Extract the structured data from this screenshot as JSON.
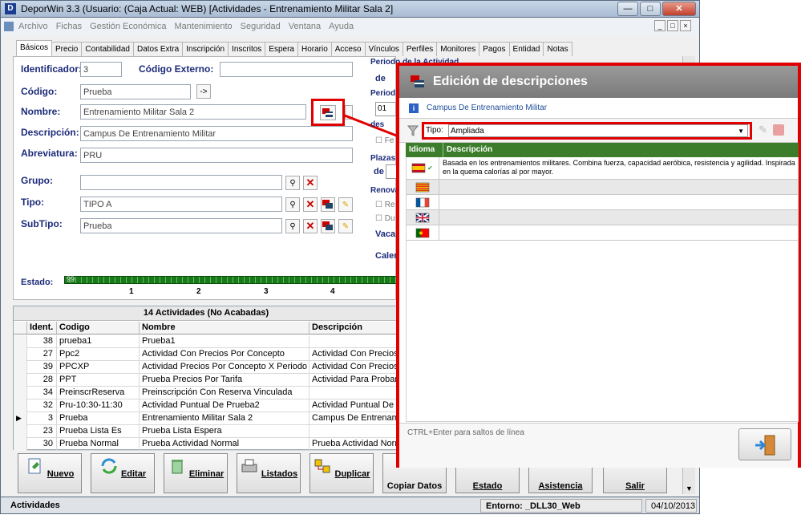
{
  "window": {
    "title": "DeporWin 3.3  (Usuario:              (Caja Actual: WEB)  [Actividades - Entrenamiento Militar Sala 2]",
    "app_icon": "D"
  },
  "menu": [
    "Archivo",
    "Fichas",
    "Gestión Económica",
    "Mantenimiento",
    "Seguridad",
    "Ventana",
    "Ayuda"
  ],
  "tabs": [
    "Básicos",
    "Precio",
    "Contabilidad",
    "Datos Extra",
    "Inscripción",
    "Inscritos",
    "Espera",
    "Horario",
    "Acceso",
    "Vínculos",
    "Perfiles",
    "Monitores",
    "Pagos",
    "Entidad",
    "Notas"
  ],
  "form": {
    "identificador_label": "Identificador:",
    "identificador": "3",
    "codigo_externo_label": "Código Externo:",
    "codigo_externo": "",
    "codigo_label": "Código:",
    "codigo": "Prueba",
    "codigo_btn": "->",
    "nombre_label": "Nombre:",
    "nombre": "Entrenamiento Militar Sala 2",
    "descripcion_label": "Descripción:",
    "descripcion": "Campus De Entrenamiento Militar",
    "abreviatura_label": "Abreviatura:",
    "abreviatura": "PRU",
    "grupo_label": "Grupo:",
    "grupo": "",
    "tipo_label": "Tipo:",
    "tipo": "TIPO A",
    "subtipo_label": "SubTipo:",
    "subtipo": "Prueba",
    "estado_label": "Estado:",
    "estado_value": "99",
    "estado_ticks": [
      "1",
      "2",
      "3",
      "4"
    ]
  },
  "right_panel": {
    "periodo_actividad": "Periodo de la Actividad",
    "de1": "de",
    "periodo2": "Period",
    "date_prefix": "01",
    "fe": "Fe",
    "desc_prefix": "des",
    "plazas": "Plazas",
    "de2": "de",
    "renova": "Renova",
    "re": "Re",
    "du": "Du",
    "vaca": "Vaca",
    "calen": "Calen"
  },
  "grid": {
    "header": "14 Actividades  (No Acabadas)",
    "columns": [
      "Ident.",
      "Codigo",
      "Nombre",
      "Descripción"
    ],
    "current_marker": "▶",
    "rows": [
      {
        "id": "38",
        "codigo": "prueba1",
        "nombre": "Prueba1",
        "descripcion": ""
      },
      {
        "id": "27",
        "codigo": "Ppc2",
        "nombre": "Actividad Con Precios Por Concepto",
        "descripcion": "Actividad Con Precios P"
      },
      {
        "id": "39",
        "codigo": "PPCXP",
        "nombre": "Actividad Precios Por Concepto X Periodo",
        "descripcion": "Actividad Con Precios P"
      },
      {
        "id": "28",
        "codigo": "PPT",
        "nombre": "Prueba Precios Por Tarifa",
        "descripcion": "Actividad Para Probar"
      },
      {
        "id": "34",
        "codigo": "PreinscrReserva",
        "nombre": "Preinscripción Con Reserva Vinculada",
        "descripcion": ""
      },
      {
        "id": "32",
        "codigo": "Pru-10:30-11:30",
        "nombre": "Actividad Puntual De Prueba2",
        "descripcion": "Actividad Puntual De"
      },
      {
        "id": "3",
        "codigo": "Prueba",
        "nombre": "Entrenamiento Militar Sala 2",
        "descripcion": "Campus De Entrenami",
        "current": true
      },
      {
        "id": "23",
        "codigo": "Prueba Lista Es",
        "nombre": "Prueba Lista Espera",
        "descripcion": ""
      },
      {
        "id": "30",
        "codigo": "Prueba Normal",
        "nombre": "Prueba Actividad Normal",
        "descripcion": "Prueba Actividad Normal"
      }
    ]
  },
  "toolbar": [
    "Nuevo",
    "Editar",
    "Eliminar",
    "Listados",
    "Duplicar",
    "Copiar Datos",
    "Estado",
    "Asistencia",
    "Salir"
  ],
  "status": {
    "left": "Actividades",
    "entorno": "Entorno: _DLL30_Web",
    "date": "04/10/2013"
  },
  "dialog": {
    "title": "Edición de descripciones",
    "subtitle": "Campus De Entrenamiento Militar",
    "tipo_label": "Tipo:",
    "tipo_value": "Ampliada",
    "col_idioma": "Idioma",
    "col_descripcion": "Descripción",
    "languages": [
      {
        "lang": "es",
        "text": "Basada en los entrenamientos militares. Combina fuerza, capacidad aeróbica, resistencia y agilidad. Inspirada en la quema calorías al por mayor."
      },
      {
        "lang": "ca",
        "text": ""
      },
      {
        "lang": "fr",
        "text": ""
      },
      {
        "lang": "en",
        "text": ""
      },
      {
        "lang": "pt",
        "text": ""
      }
    ],
    "hint": "CTRL+Enter para saltos de línea"
  },
  "colors": {
    "accent_red": "#e00000",
    "header_green": "#3b7d2a",
    "estado_green": "#1a7a1a",
    "label_blue": "#1c2b7a"
  }
}
